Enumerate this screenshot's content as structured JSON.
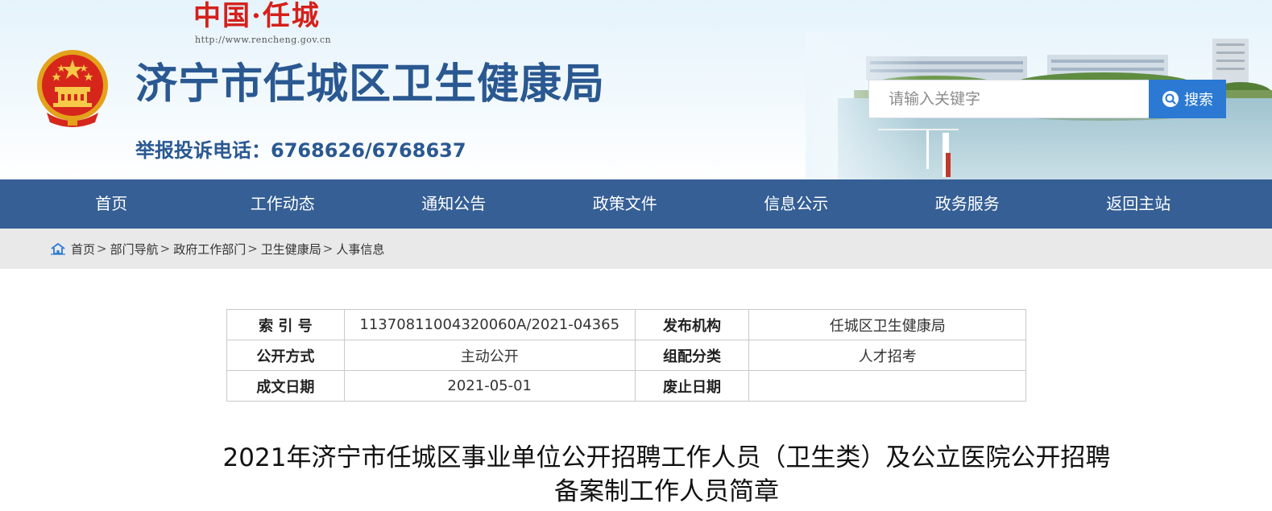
{
  "header": {
    "logo_text": "中国·任城",
    "logo_url": "http://www.rencheng.gov.cn",
    "site_title": "济宁市任城区卫生健康局",
    "hotline": "举报投诉电话：6768626/6768637",
    "search": {
      "placeholder": "请输入关键字",
      "button_label": "搜索"
    }
  },
  "nav": {
    "items": [
      {
        "label": "首页"
      },
      {
        "label": "工作动态"
      },
      {
        "label": "通知公告"
      },
      {
        "label": "政策文件"
      },
      {
        "label": "信息公示"
      },
      {
        "label": "政务服务"
      },
      {
        "label": "返回主站"
      }
    ]
  },
  "breadcrumb": {
    "items": [
      "首页",
      "部门导航",
      "政府工作部门",
      "卫生健康局",
      "人事信息"
    ],
    "separator": ">"
  },
  "meta": {
    "rows": [
      {
        "k1": "索 引 号",
        "v1": "11370811004320060A/2021-04365",
        "k2": "发布机构",
        "v2": "任城区卫生健康局"
      },
      {
        "k1": "公开方式",
        "v1": "主动公开",
        "k2": "组配分类",
        "v2": "人才招考"
      },
      {
        "k1": "成文日期",
        "v1": "2021-05-01",
        "k2": "废止日期",
        "v2": ""
      }
    ]
  },
  "article": {
    "title_line1": "2021年济宁市任城区事业单位公开招聘工作人员（卫生类）及公立医院公开招聘",
    "title_line2": "备案制工作人员简章"
  },
  "colors": {
    "brand_blue": "#2a5891",
    "nav_bg": "#355f95",
    "search_button": "#2b79d3",
    "logo_red": "#d4201a"
  }
}
